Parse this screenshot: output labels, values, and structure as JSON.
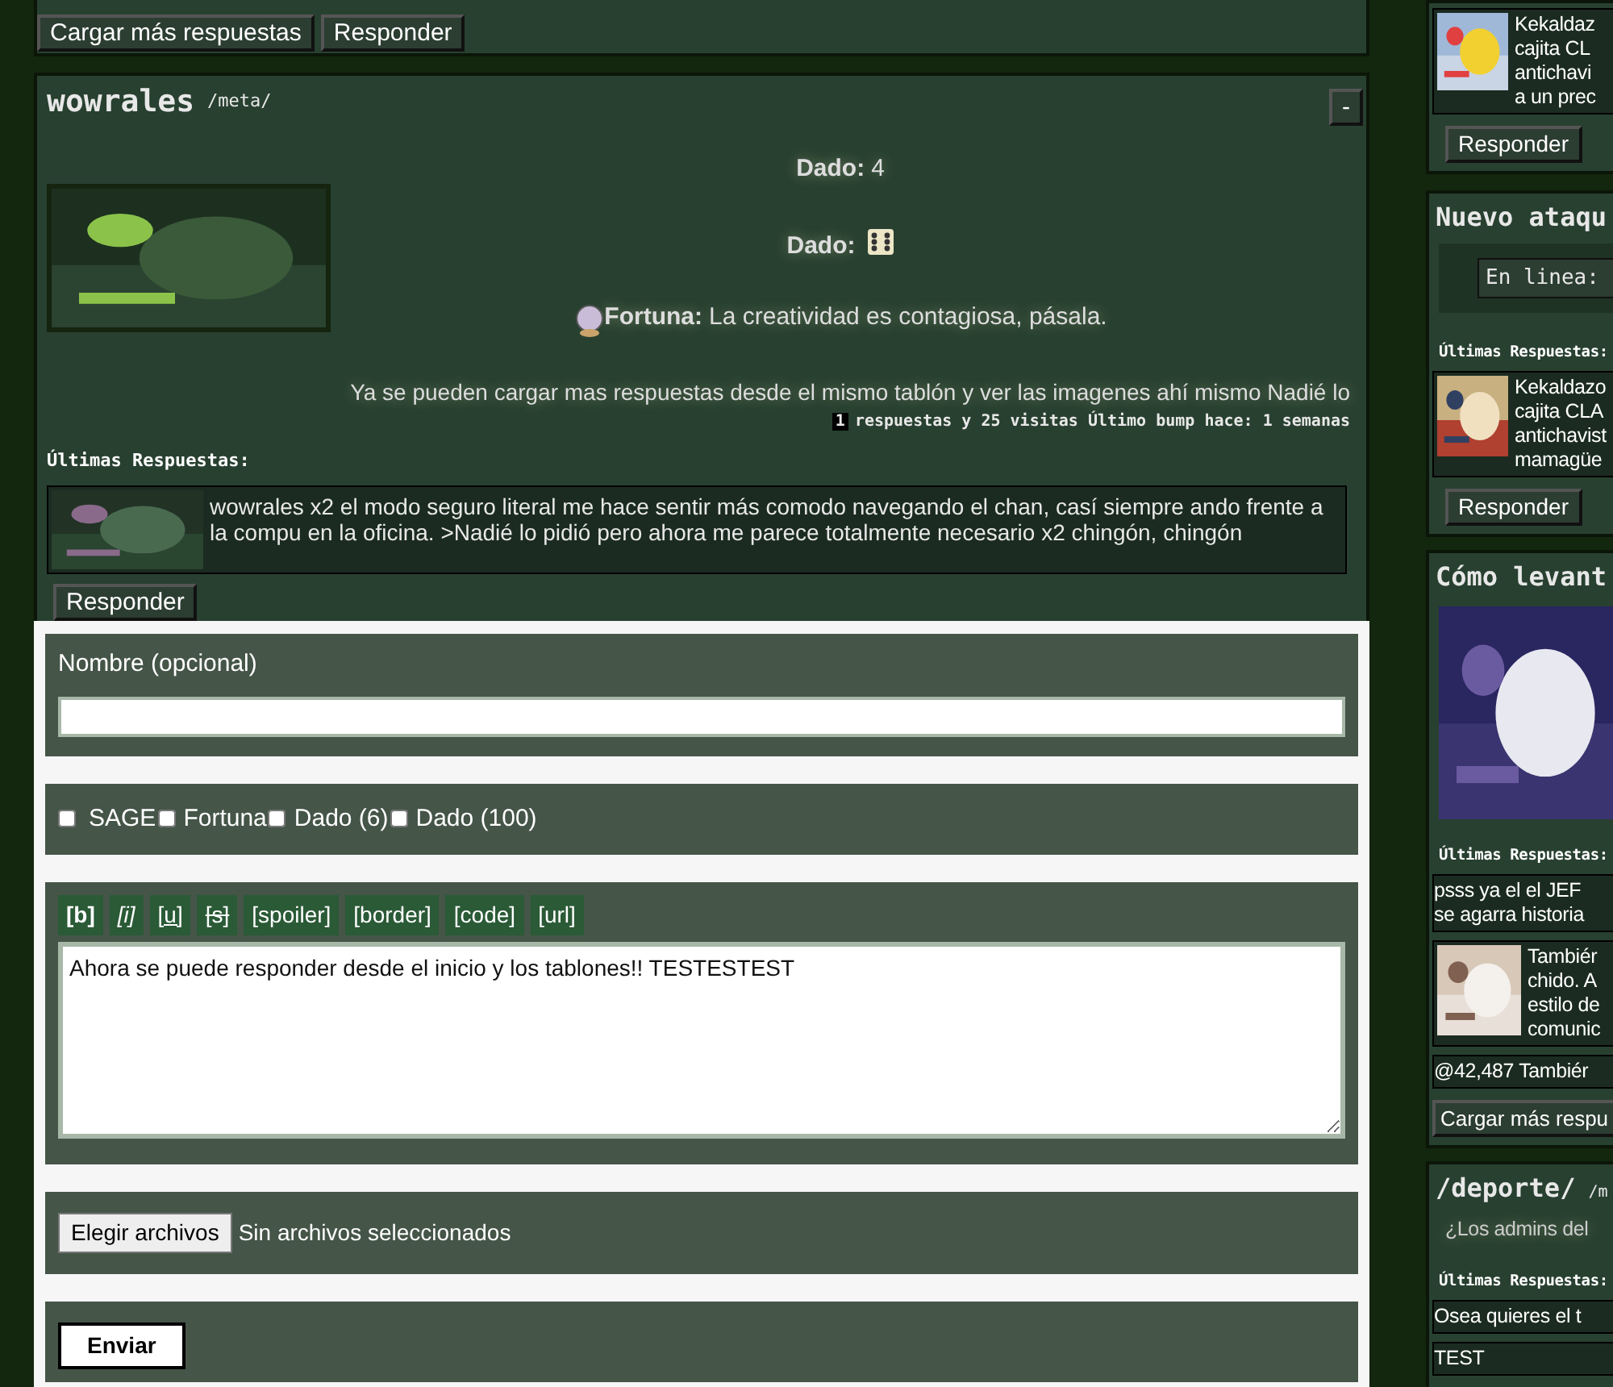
{
  "top_panel": {
    "buttons": [
      "Cargar más respuestas",
      "Responder"
    ]
  },
  "thread": {
    "title": "wowrales",
    "board": "/meta/",
    "collapse": "-",
    "dice": [
      {
        "kind": "number",
        "label": "Dado:",
        "value": "4"
      },
      {
        "kind": "die",
        "label": "Dado:"
      }
    ],
    "fortune": {
      "label": "Fortuna:",
      "text": "La creatividad es contagiosa, pásala."
    },
    "body": "Ya se pueden cargar mas respuestas desde el mismo tablón y ver las imagenes ahí mismo Nadié lo",
    "stats": {
      "count": "1",
      "text": "respuestas y 25 visitas Último bump hace: 1 semanas"
    },
    "replies_heading": "Últimas Respuestas:",
    "replies": [
      {
        "text": "wowrales x2 el modo seguro literal me hace sentir más comodo navegando el chan, casí siempre ando frente a la compu en la oficina. >Nadié lo pidió pero ahora me parece totalmente necesario x2 chingón, chingón"
      }
    ],
    "reply_button": "Responder"
  },
  "form": {
    "name_label": "Nombre (opcional)",
    "options": [
      {
        "label": "SAGE",
        "checked": false
      },
      {
        "label": "Fortuna",
        "checked": false
      },
      {
        "label": "Dado (6)",
        "checked": false
      },
      {
        "label": "Dado (100)",
        "checked": false
      }
    ],
    "format_buttons": [
      {
        "label": "[b]",
        "kind": "bold"
      },
      {
        "label": "[i]",
        "kind": "italic"
      },
      {
        "label": "[u]",
        "kind": "underline"
      },
      {
        "label": "[s]",
        "kind": "strike"
      },
      {
        "label": "[spoiler]",
        "kind": "plain"
      },
      {
        "label": "[border]",
        "kind": "plain"
      },
      {
        "label": "[code]",
        "kind": "plain"
      },
      {
        "label": "[url]",
        "kind": "plain"
      }
    ],
    "message": "Ahora se puede responder desde el inicio y los tablones!! TESTESTEST",
    "file_button": "Elegir archivos",
    "file_status": "Sin archivos seleccionados",
    "submit": "Enviar"
  },
  "sidebar": [
    {
      "replies": [
        {
          "lines": [
            "Kekaldaz",
            "cajita CL",
            "antichavi",
            "a un prec"
          ]
        }
      ],
      "button": "Responder"
    },
    {
      "title": "Nuevo ataqu",
      "online": "En linea:",
      "replies_heading": "Últimas Respuestas:",
      "replies": [
        {
          "lines": [
            "Kekaldazo",
            "cajita CLA",
            "antichavist",
            "mamagüe"
          ]
        }
      ],
      "button": "Responder"
    },
    {
      "title": "Cómo levant",
      "picture": true,
      "replies_heading": "Últimas Respuestas:",
      "replies": [
        {
          "kind": "text",
          "lines": [
            "psss ya el el JEF",
            "se agarra historia"
          ]
        },
        {
          "lines": [
            "Tambiér",
            "chido. A",
            "estilo de",
            "comunic"
          ]
        },
        {
          "kind": "text",
          "lines": [
            "@42,487 Tambiér"
          ]
        }
      ],
      "button": "Cargar más respu"
    },
    {
      "title": "/deporte/",
      "board": "/m",
      "summary": "¿Los admins del",
      "replies_heading": "Últimas Respuestas:",
      "replies": [
        {
          "kind": "text",
          "lines": [
            "Osea quieres el t"
          ]
        },
        {
          "kind": "text",
          "lines": [
            "TEST"
          ]
        }
      ]
    }
  ]
}
